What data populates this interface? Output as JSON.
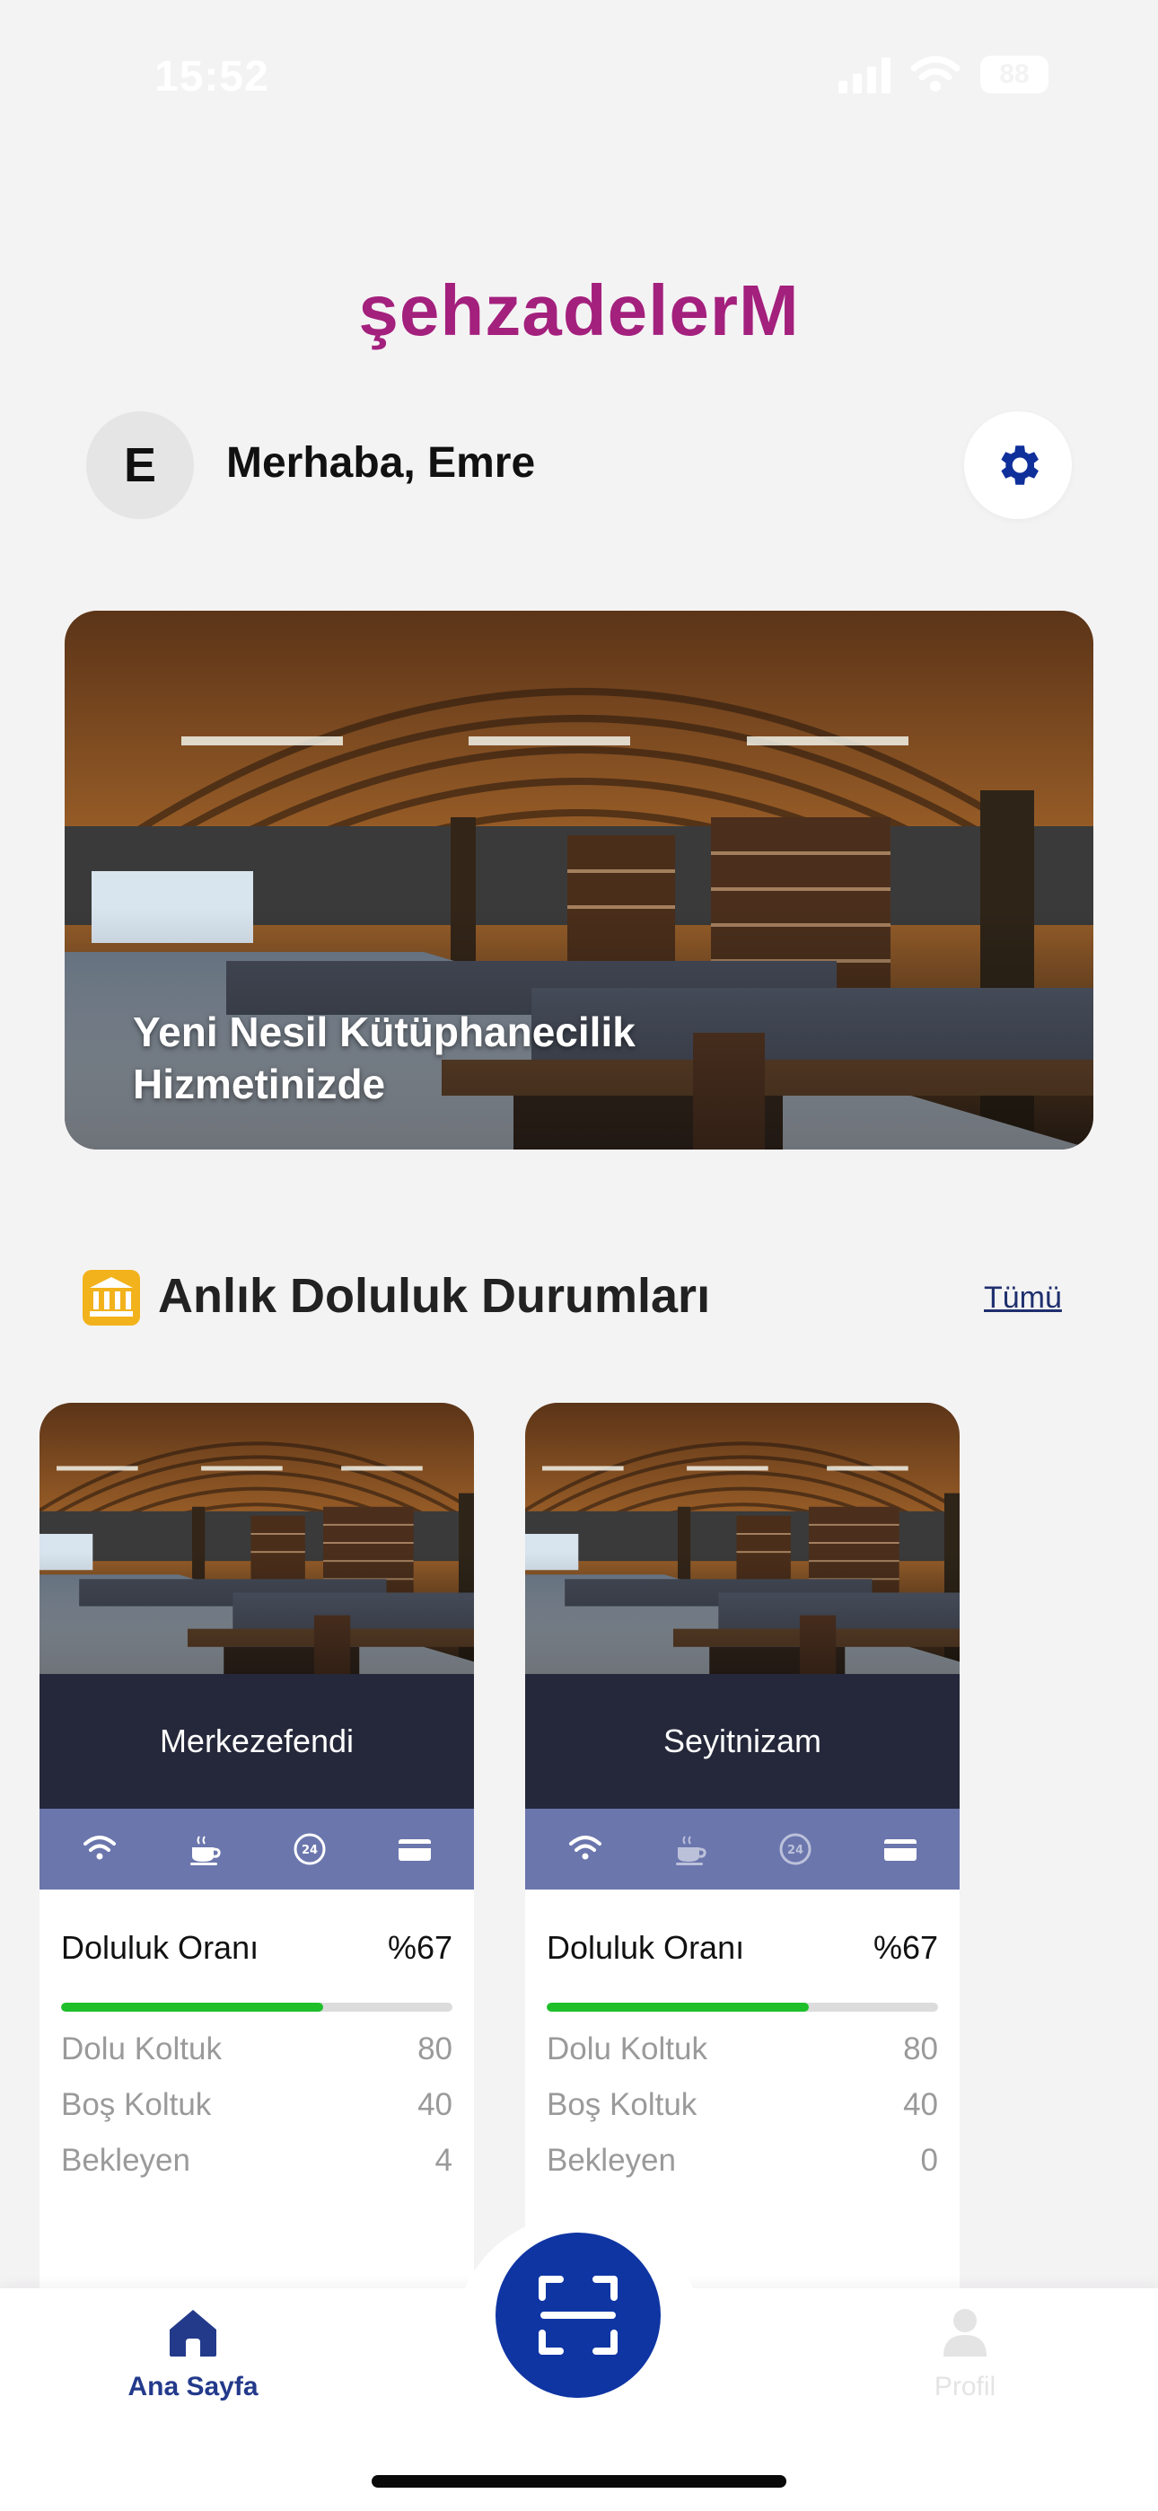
{
  "status_bar": {
    "time": "15:52",
    "battery": "88"
  },
  "brand": {
    "name": "şehzadelerM",
    "color": "#a3207d"
  },
  "greeting": {
    "avatar_initial": "E",
    "text": "Merhaba, Emre",
    "settings_icon": "gear-icon"
  },
  "hero": {
    "caption_line1": "Yeni Nesil Kütüphanecilik",
    "caption_line2": "Hizmetinizde"
  },
  "section": {
    "icon": "library-icon",
    "title": "Anlık Doluluk Durumları",
    "link": "Tümü"
  },
  "cards": [
    {
      "name": "Merkezefendi",
      "amenities": [
        "wifi-icon",
        "coffee-icon",
        "24h-icon",
        "card-icon"
      ],
      "occupancy_label": "Doluluk Oranı",
      "occupancy": "%67",
      "occupancy_fraction": 0.67,
      "stats": [
        {
          "label": "Dolu Koltuk",
          "value": "80"
        },
        {
          "label": "Boş Koltuk",
          "value": "40"
        },
        {
          "label": "Bekleyen",
          "value": "4"
        }
      ]
    },
    {
      "name": "Seyitnizam",
      "amenities": [
        "wifi-icon",
        "coffee-icon",
        "24h-icon",
        "card-icon"
      ],
      "occupancy_label": "Doluluk Oranı",
      "occupancy": "%67",
      "occupancy_fraction": 0.67,
      "stats": [
        {
          "label": "Dolu Koltuk",
          "value": "80"
        },
        {
          "label": "Boş Koltuk",
          "value": "40"
        },
        {
          "label": "Bekleyen",
          "value": "0"
        }
      ]
    }
  ],
  "bottom_nav": {
    "home_label": "Ana Sayfa",
    "profile_label": "Profil",
    "scan_icon": "qr-scan-icon",
    "accent": "#0f35a3"
  }
}
